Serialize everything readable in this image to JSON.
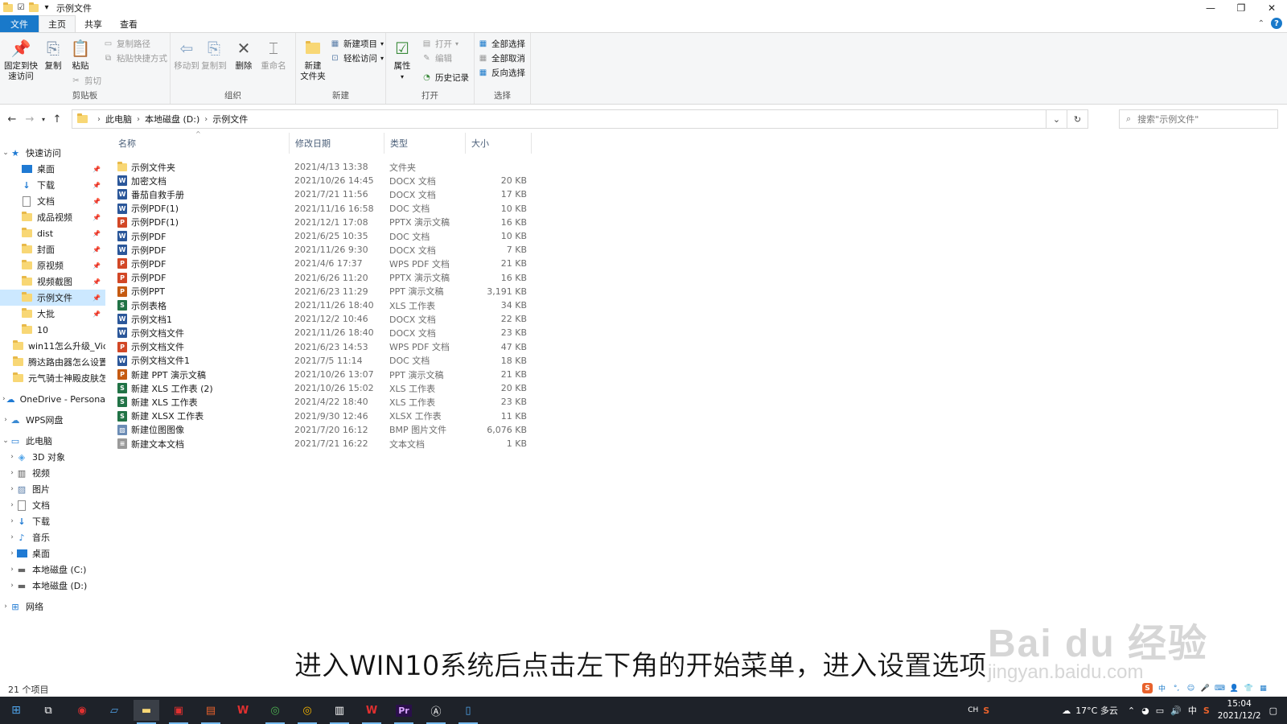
{
  "window": {
    "title": "示例文件",
    "controls": [
      "minimize-icon",
      "restore-icon",
      "close-icon"
    ]
  },
  "ribbon_tabs": [
    {
      "label": "文件"
    },
    {
      "label": "主页"
    },
    {
      "label": "共享"
    },
    {
      "label": "查看"
    }
  ],
  "ribbon": {
    "clipboard": {
      "label": "剪贴板",
      "pin": "固定到快\n速访问",
      "copy": "复制",
      "paste": "粘贴",
      "copy_path": "复制路径",
      "paste_shortcut": "粘贴快捷方式",
      "cut": "剪切"
    },
    "organize": {
      "label": "组织",
      "move_to": "移动到",
      "copy_to": "复制到",
      "delete": "删除",
      "rename": "重命名"
    },
    "new": {
      "label": "新建",
      "new_folder": "新建\n文件夹",
      "new_item": "新建项目",
      "easy_access": "轻松访问"
    },
    "open": {
      "label": "打开",
      "properties": "属性",
      "open": "打开",
      "edit": "编辑",
      "history": "历史记录"
    },
    "select": {
      "label": "选择",
      "select_all": "全部选择",
      "select_none": "全部取消",
      "invert": "反向选择"
    }
  },
  "address": {
    "crumbs": [
      "此电脑",
      "本地磁盘 (D:)",
      "示例文件"
    ],
    "search_placeholder": "搜索\"示例文件\""
  },
  "nav_tree": {
    "quick_access": "快速访问",
    "quick_items": [
      {
        "label": "桌面",
        "icon": "desktop-icon",
        "pinned": true
      },
      {
        "label": "下载",
        "icon": "download-icon",
        "pinned": true
      },
      {
        "label": "文档",
        "icon": "document-icon",
        "pinned": true
      },
      {
        "label": "成品视频",
        "icon": "folder-icon",
        "pinned": true
      },
      {
        "label": "dist",
        "icon": "folder-icon",
        "pinned": true
      },
      {
        "label": "封面",
        "icon": "folder-icon",
        "pinned": true
      },
      {
        "label": "原视频",
        "icon": "folder-icon",
        "pinned": true
      },
      {
        "label": "视频截图",
        "icon": "folder-icon",
        "pinned": true
      },
      {
        "label": "示例文件",
        "icon": "folder-icon",
        "pinned": true,
        "selected": true
      },
      {
        "label": "大批",
        "icon": "folder-icon",
        "pinned": true
      },
      {
        "label": "10",
        "icon": "folder-icon",
        "pinned": false
      },
      {
        "label": "win11怎么升级_Vid",
        "icon": "folder-icon",
        "pinned": false
      },
      {
        "label": "腾达路由器怎么设置",
        "icon": "folder-icon",
        "pinned": false
      },
      {
        "label": "元气骑士神殿皮肤怎",
        "icon": "folder-icon",
        "pinned": false
      }
    ],
    "onedrive": "OneDrive - Persona",
    "wps": "WPS网盘",
    "this_pc": "此电脑",
    "pc_items": [
      {
        "label": "3D 对象",
        "icon": "3d-objects-icon"
      },
      {
        "label": "视频",
        "icon": "video-icon"
      },
      {
        "label": "图片",
        "icon": "picture-icon"
      },
      {
        "label": "文档",
        "icon": "document-icon"
      },
      {
        "label": "下载",
        "icon": "download-icon"
      },
      {
        "label": "音乐",
        "icon": "music-icon"
      },
      {
        "label": "桌面",
        "icon": "desktop-icon"
      },
      {
        "label": "本地磁盘 (C:)",
        "icon": "drive-icon"
      },
      {
        "label": "本地磁盘 (D:)",
        "icon": "drive-icon"
      }
    ],
    "network": "网络"
  },
  "columns": {
    "name": "名称",
    "date": "修改日期",
    "type": "类型",
    "size": "大小"
  },
  "files": [
    {
      "name": "示例文件夹",
      "date": "2021/4/13 13:38",
      "type": "文件夹",
      "size": "",
      "icon": "folder"
    },
    {
      "name": "加密文档",
      "date": "2021/10/26 14:45",
      "type": "DOCX 文档",
      "size": "20 KB",
      "icon": "word"
    },
    {
      "name": "番茄自救手册",
      "date": "2021/7/21 11:56",
      "type": "DOCX 文档",
      "size": "17 KB",
      "icon": "word"
    },
    {
      "name": "示例PDF(1)",
      "date": "2021/11/16 16:58",
      "type": "DOC 文档",
      "size": "10 KB",
      "icon": "word"
    },
    {
      "name": "示例PDF(1)",
      "date": "2021/12/1 17:08",
      "type": "PPTX 演示文稿",
      "size": "16 KB",
      "icon": "pdf"
    },
    {
      "name": "示例PDF",
      "date": "2021/6/25 10:35",
      "type": "DOC 文档",
      "size": "10 KB",
      "icon": "word"
    },
    {
      "name": "示例PDF",
      "date": "2021/11/26 9:30",
      "type": "DOCX 文档",
      "size": "7 KB",
      "icon": "word"
    },
    {
      "name": "示例PDF",
      "date": "2021/4/6 17:37",
      "type": "WPS PDF 文档",
      "size": "21 KB",
      "icon": "pdf"
    },
    {
      "name": "示例PDF",
      "date": "2021/6/26 11:20",
      "type": "PPTX 演示文稿",
      "size": "16 KB",
      "icon": "pdf"
    },
    {
      "name": "示例PPT",
      "date": "2021/6/23 11:29",
      "type": "PPT 演示文稿",
      "size": "3,191 KB",
      "icon": "ppt"
    },
    {
      "name": "示例表格",
      "date": "2021/11/26 18:40",
      "type": "XLS 工作表",
      "size": "34 KB",
      "icon": "excel"
    },
    {
      "name": "示例文档1",
      "date": "2021/12/2 10:46",
      "type": "DOCX 文档",
      "size": "22 KB",
      "icon": "word"
    },
    {
      "name": "示例文档文件",
      "date": "2021/11/26 18:40",
      "type": "DOCX 文档",
      "size": "23 KB",
      "icon": "word"
    },
    {
      "name": "示例文档文件",
      "date": "2021/6/23 14:53",
      "type": "WPS PDF 文档",
      "size": "47 KB",
      "icon": "pdf"
    },
    {
      "name": "示例文档文件1",
      "date": "2021/7/5 11:14",
      "type": "DOC 文档",
      "size": "18 KB",
      "icon": "word"
    },
    {
      "name": "新建 PPT 演示文稿",
      "date": "2021/10/26 13:07",
      "type": "PPT 演示文稿",
      "size": "21 KB",
      "icon": "ppt"
    },
    {
      "name": "新建 XLS 工作表 (2)",
      "date": "2021/10/26 15:02",
      "type": "XLS 工作表",
      "size": "20 KB",
      "icon": "excel"
    },
    {
      "name": "新建 XLS 工作表",
      "date": "2021/4/22 18:40",
      "type": "XLS 工作表",
      "size": "23 KB",
      "icon": "excel"
    },
    {
      "name": "新建 XLSX 工作表",
      "date": "2021/9/30 12:46",
      "type": "XLSX 工作表",
      "size": "11 KB",
      "icon": "excel"
    },
    {
      "name": "新建位图图像",
      "date": "2021/7/20 16:12",
      "type": "BMP 图片文件",
      "size": "6,076 KB",
      "icon": "bmp"
    },
    {
      "name": "新建文本文档",
      "date": "2021/7/21 16:22",
      "type": "文本文档",
      "size": "1 KB",
      "icon": "txt"
    }
  ],
  "status": {
    "item_count": "21 个项目"
  },
  "overlay": {
    "subtitle": "进入WIN10系统后点击左下角的开始菜单，进入设置选项",
    "watermark_main": "Bai du 经验",
    "watermark_sub": "jingyan.baidu.com"
  },
  "taskbar": {
    "weather": "17°C  多云",
    "ime_lang": "中",
    "ch_label": "CH",
    "time": "15:04",
    "date": "2021/12/2"
  },
  "colors": {
    "accent": "#1979ca",
    "selection": "#cce8ff",
    "taskbar": "#1e2229",
    "folder": "#f8d775"
  }
}
